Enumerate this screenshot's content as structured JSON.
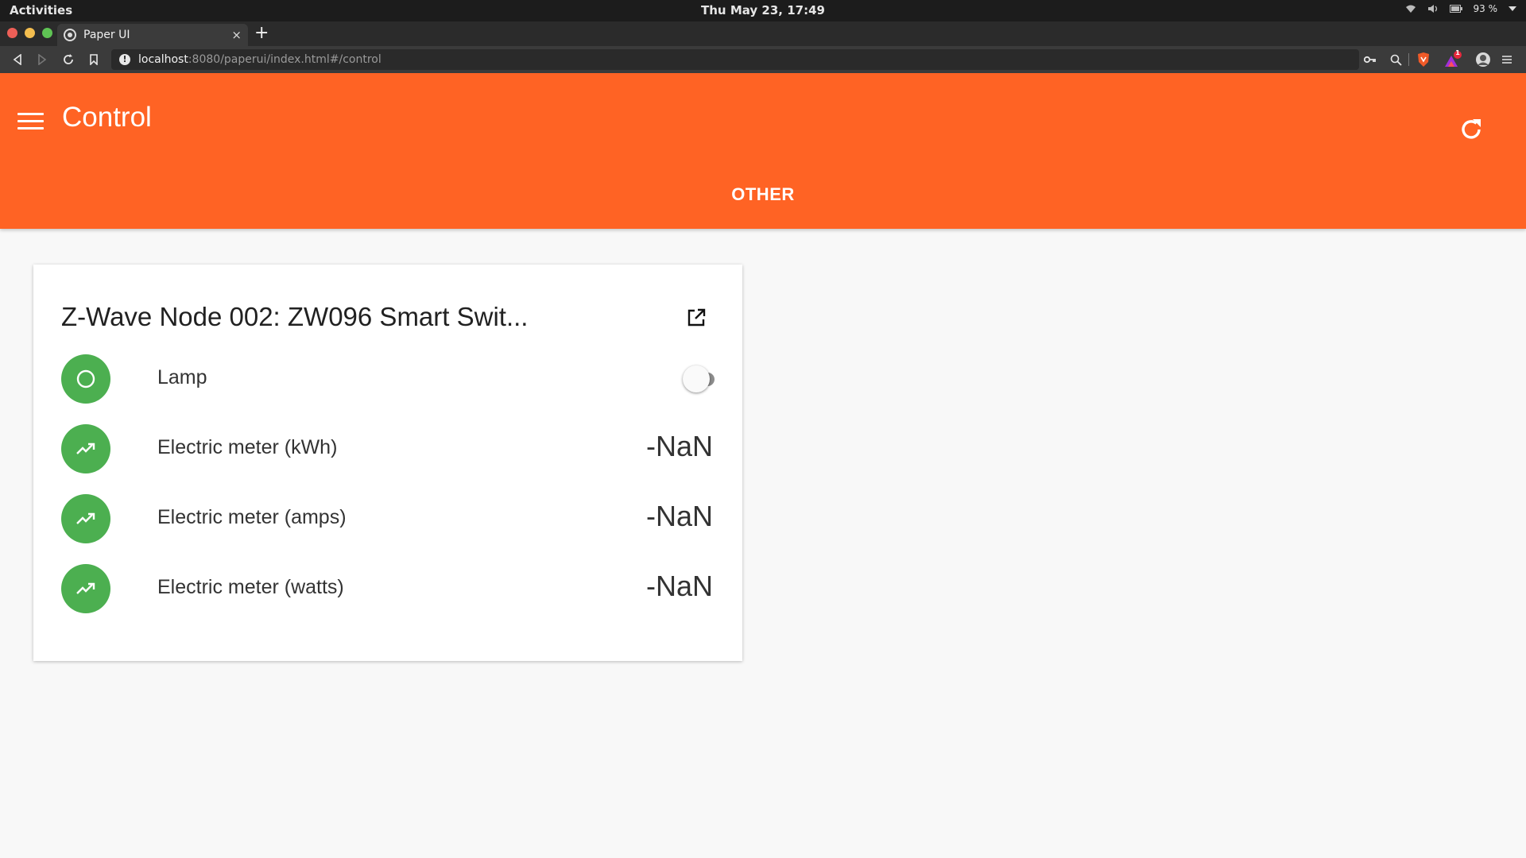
{
  "os": {
    "activities": "Activities",
    "clock": "Thu May 23, 17:49",
    "battery": "93 %"
  },
  "browser": {
    "tab_title": "Paper UI",
    "tab_close": "×",
    "new_tab": "+",
    "url_host": "localhost",
    "url_path": ":8080/paperui/index.html#/control",
    "info_glyph": "!",
    "brave_badge": "1"
  },
  "header": {
    "title": "Control",
    "tab": "OTHER",
    "color": "#ff6324"
  },
  "card": {
    "title": "Z-Wave Node 002: ZW096 Smart Swit...",
    "items": [
      {
        "label": "Lamp",
        "icon": "circle-icon",
        "toggle_on": false
      },
      {
        "label": "Electric meter (kWh)",
        "icon": "trending-up-icon",
        "value": "-NaN"
      },
      {
        "label": "Electric meter (amps)",
        "icon": "trending-up-icon",
        "value": "-NaN"
      },
      {
        "label": "Electric meter (watts)",
        "icon": "trending-up-icon",
        "value": "-NaN"
      }
    ],
    "icon_color": "#4caf50"
  }
}
